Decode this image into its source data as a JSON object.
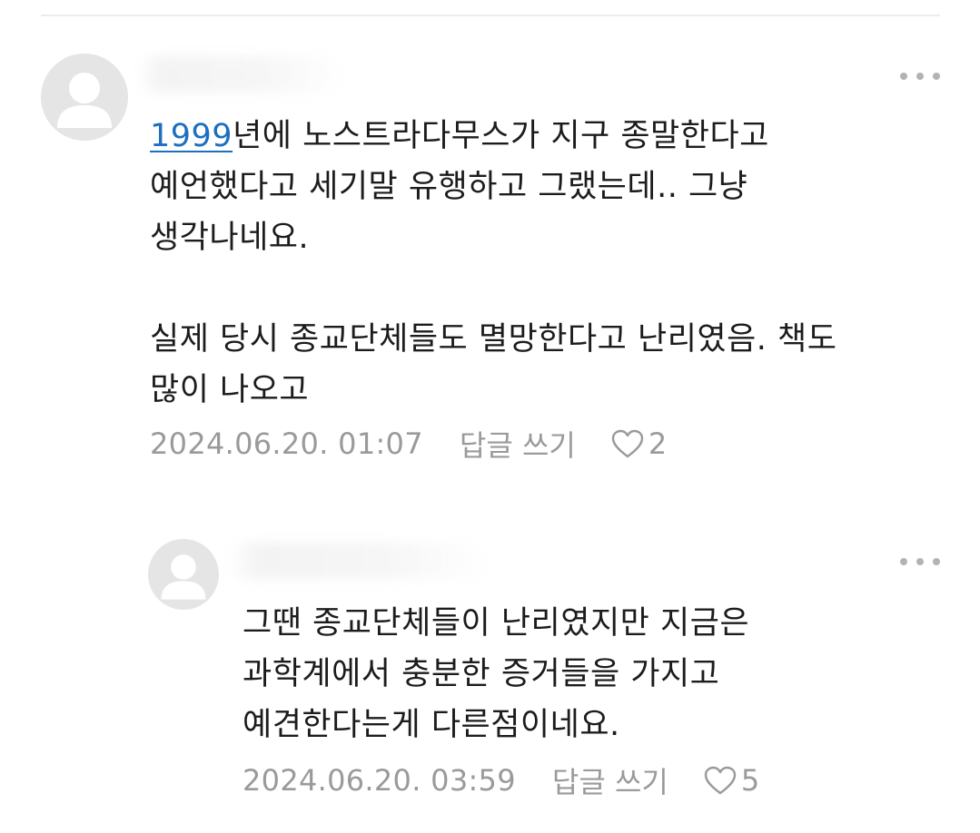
{
  "comments": [
    {
      "year_link": "1999",
      "text_after_link": "년에 노스트라다무스가 지구 종말한다고\n예언했다고 세기말 유행하고 그랬는데.. 그냥\n생각나네요.\n\n실제 당시 종교단체들도 멸망한다고 난리였음. 책도\n많이 나오고",
      "date": "2024.06.20. 01:07",
      "reply_label": "답글 쓰기",
      "like_count": "2"
    },
    {
      "text": "그땐 종교단체들이 난리였지만 지금은\n과학계에서 충분한 증거들을 가지고\n예견한다는게 다른점이네요.",
      "date": "2024.06.20. 03:59",
      "reply_label": "답글 쓰기",
      "like_count": "5"
    }
  ],
  "icons": {
    "avatar": "person-silhouette-icon",
    "more": "more-dots-icon",
    "like": "heart-outline-icon"
  },
  "colors": {
    "link": "#1d6fc0",
    "meta": "#9a9a9a",
    "avatar_bg": "#e5e5e5",
    "avatar_fg": "#ffffff"
  }
}
